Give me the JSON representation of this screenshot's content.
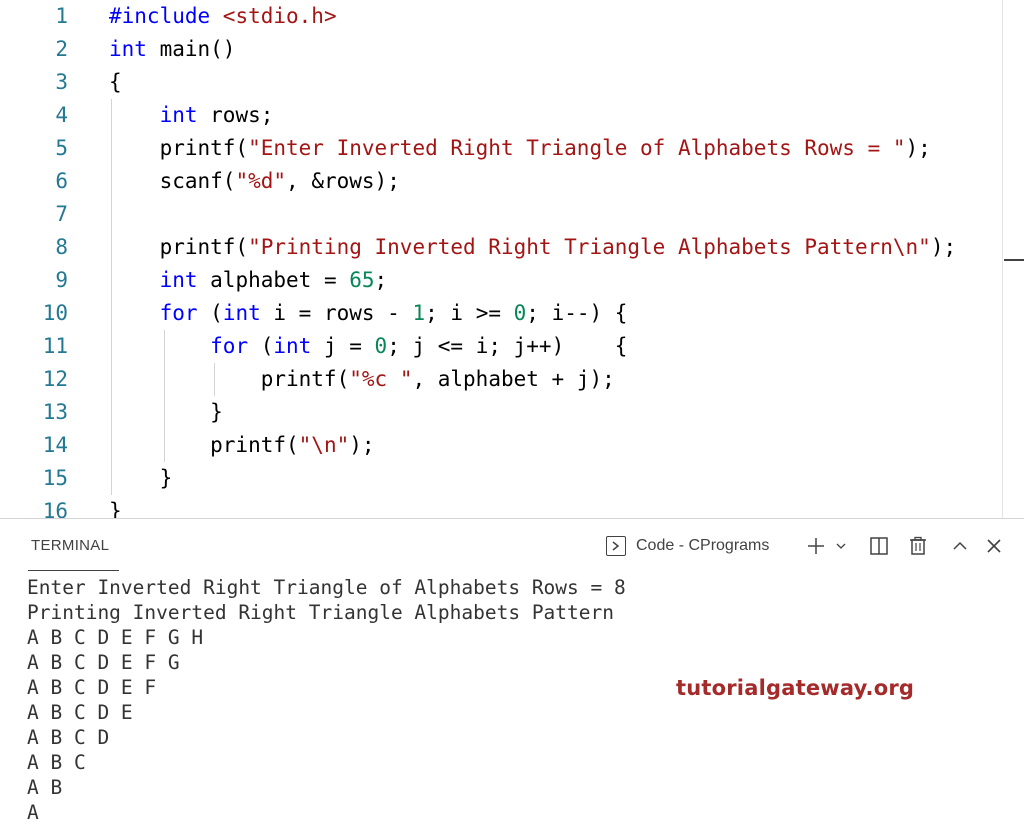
{
  "editor": {
    "lines": [
      {
        "num": "1",
        "tokens": [
          {
            "t": "#include ",
            "c": "kw"
          },
          {
            "t": "<stdio.h>",
            "c": "str"
          }
        ]
      },
      {
        "num": "2",
        "tokens": [
          {
            "t": "int",
            "c": "kw"
          },
          {
            "t": " main()",
            "c": ""
          }
        ]
      },
      {
        "num": "3",
        "tokens": [
          {
            "t": "{",
            "c": ""
          }
        ]
      },
      {
        "num": "4",
        "tokens": [
          {
            "t": "    ",
            "c": ""
          },
          {
            "t": "int",
            "c": "kw"
          },
          {
            "t": " rows;",
            "c": ""
          }
        ]
      },
      {
        "num": "5",
        "tokens": [
          {
            "t": "    printf(",
            "c": ""
          },
          {
            "t": "\"Enter Inverted Right Triangle of Alphabets Rows = \"",
            "c": "str"
          },
          {
            "t": ");",
            "c": ""
          }
        ]
      },
      {
        "num": "6",
        "tokens": [
          {
            "t": "    scanf(",
            "c": ""
          },
          {
            "t": "\"",
            "c": "str"
          },
          {
            "t": "%d",
            "c": "str"
          },
          {
            "t": "\"",
            "c": "str"
          },
          {
            "t": ", &rows);",
            "c": ""
          }
        ]
      },
      {
        "num": "7",
        "tokens": []
      },
      {
        "num": "8",
        "tokens": [
          {
            "t": "    printf(",
            "c": ""
          },
          {
            "t": "\"Printing Inverted Right Triangle Alphabets Pattern",
            "c": "str"
          },
          {
            "t": "\\n",
            "c": "str"
          },
          {
            "t": "\"",
            "c": "str"
          },
          {
            "t": ");",
            "c": ""
          }
        ]
      },
      {
        "num": "9",
        "tokens": [
          {
            "t": "    ",
            "c": ""
          },
          {
            "t": "int",
            "c": "kw"
          },
          {
            "t": " alphabet = ",
            "c": ""
          },
          {
            "t": "65",
            "c": "num"
          },
          {
            "t": ";",
            "c": ""
          }
        ]
      },
      {
        "num": "10",
        "tokens": [
          {
            "t": "    ",
            "c": ""
          },
          {
            "t": "for",
            "c": "kw"
          },
          {
            "t": " (",
            "c": ""
          },
          {
            "t": "int",
            "c": "kw"
          },
          {
            "t": " i = rows - ",
            "c": ""
          },
          {
            "t": "1",
            "c": "num"
          },
          {
            "t": "; i >= ",
            "c": ""
          },
          {
            "t": "0",
            "c": "num"
          },
          {
            "t": "; i--) {",
            "c": ""
          }
        ]
      },
      {
        "num": "11",
        "tokens": [
          {
            "t": "        ",
            "c": ""
          },
          {
            "t": "for",
            "c": "kw"
          },
          {
            "t": " (",
            "c": ""
          },
          {
            "t": "int",
            "c": "kw"
          },
          {
            "t": " j = ",
            "c": ""
          },
          {
            "t": "0",
            "c": "num"
          },
          {
            "t": "; j <= i; j++)    {",
            "c": ""
          }
        ]
      },
      {
        "num": "12",
        "tokens": [
          {
            "t": "            printf(",
            "c": ""
          },
          {
            "t": "\"",
            "c": "str"
          },
          {
            "t": "%c",
            "c": "str"
          },
          {
            "t": " \"",
            "c": "str"
          },
          {
            "t": ", alphabet + j);",
            "c": ""
          }
        ]
      },
      {
        "num": "13",
        "tokens": [
          {
            "t": "        }",
            "c": ""
          }
        ]
      },
      {
        "num": "14",
        "tokens": [
          {
            "t": "        printf(",
            "c": ""
          },
          {
            "t": "\"\\n\"",
            "c": "str"
          },
          {
            "t": ");",
            "c": ""
          }
        ]
      },
      {
        "num": "15",
        "tokens": [
          {
            "t": "    }",
            "c": ""
          }
        ]
      },
      {
        "num": "16",
        "tokens": [
          {
            "t": "}",
            "c": ""
          }
        ]
      }
    ]
  },
  "panel": {
    "tab_label": "TERMINAL",
    "terminal_name": "Code - CPrograms",
    "icons": {
      "terminal": "terminal-icon",
      "add": "plus-icon",
      "dropdown": "chevron-down-icon",
      "split": "split-terminal-icon",
      "kill": "trash-icon",
      "maximize": "chevron-up-icon",
      "close": "close-icon"
    }
  },
  "terminal": {
    "lines": [
      "Enter Inverted Right Triangle of Alphabets Rows = 8",
      "Printing Inverted Right Triangle Alphabets Pattern",
      "A B C D E F G H",
      "A B C D E F G",
      "A B C D E F",
      "A B C D E",
      "A B C D",
      "A B C",
      "A B",
      "A"
    ]
  },
  "watermark": "tutorialgateway.org",
  "colors": {
    "keyword": "#0000ff",
    "string": "#a31515",
    "number": "#098658",
    "line_number": "#237893",
    "watermark": "#a52a2a"
  }
}
